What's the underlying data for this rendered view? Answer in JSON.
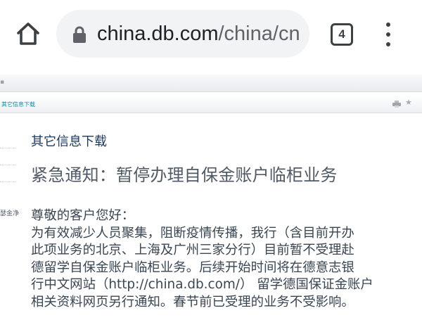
{
  "browser": {
    "url_host": "china.db.com",
    "url_path": "/china/cn",
    "tab_count": "4",
    "icons": {
      "home": "home-icon",
      "lock": "lock-icon",
      "tabs": "tab-switcher-icon",
      "menu": "overflow-menu-icon"
    }
  },
  "site_header": {
    "breadcrumb": "其它信息下载",
    "icons": {
      "print": "print-icon",
      "favorite": "star-icon"
    }
  },
  "sidebar": {
    "partial_text": "瑟金净"
  },
  "main": {
    "section_title": "其它信息下载",
    "notice_title": "紧急通知：暂停办理自保金账户临柜业务",
    "lines": [
      "尊敬的客户您好：",
      "为有效减少人员聚集，阻断疫情传播，我行（含目前开办",
      "此项业务的北京、上海及广州三家分行）目前暂不受理赴",
      "德留学自保金账户临柜业务。后续开始时间将在德意志银",
      "行中文网站（http://china.db.com/） 留学德国保证金账户",
      "相关资料网页另行通知。春节前已受理的业务不受影响。"
    ]
  },
  "colors": {
    "section_title": "#1c3a60",
    "notice_title": "#4f5a66",
    "body_text": "#3a4652",
    "breadcrumb": "#0a8fa8",
    "omnibox_bg": "#f1f3f4"
  }
}
